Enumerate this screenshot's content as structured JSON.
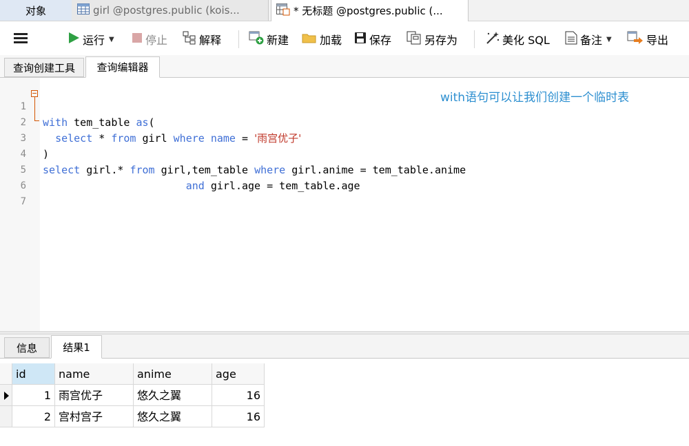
{
  "tabs": {
    "objects": "对象",
    "doc1": "girl @postgres.public (kois...",
    "doc2": "* 无标题 @postgres.public (..."
  },
  "toolbar": {
    "run": "运行",
    "stop": "停止",
    "explain": "解释",
    "new": "新建",
    "load": "加载",
    "save": "保存",
    "save_as": "另存为",
    "beautify": "美化 SQL",
    "note": "备注",
    "export": "导出"
  },
  "subtabs": {
    "builder": "查询创建工具",
    "editor": "查询编辑器"
  },
  "editor": {
    "line_numbers": [
      "1",
      "2",
      "3",
      "4",
      "5",
      "6",
      "7"
    ],
    "l1": {
      "kw1": "with",
      "t1": " tem_table ",
      "kw2": "as",
      "t2": "("
    },
    "l2": {
      "pad": "  ",
      "kw1": "select",
      "t1": " * ",
      "kw2": "from",
      "t2": " girl ",
      "kw3": "where",
      "t3": " ",
      "kw4": "name",
      "t4": " = ",
      "str": "'雨宫优子'"
    },
    "l3": {
      "t1": ")"
    },
    "l4": {
      "kw1": "select",
      "t1": " girl.* ",
      "kw2": "from",
      "t2": " girl,tem_table ",
      "kw3": "where",
      "t3": " girl.anime = tem_table.anime"
    },
    "l5": {
      "pad": "                       ",
      "kw1": "and",
      "t1": " girl.age = tem_table.age"
    },
    "annotation": "with语句可以让我们创建一个临时表"
  },
  "result_tabs": {
    "info": "信息",
    "result": "结果1"
  },
  "result": {
    "columns": [
      "id",
      "name",
      "anime",
      "age"
    ],
    "rows": [
      [
        "1",
        "雨宫优子",
        "悠久之翼",
        "16"
      ],
      [
        "2",
        "宫村宫子",
        "悠久之翼",
        "16"
      ]
    ]
  },
  "colors": {
    "keyword": "#3f6fd6",
    "string": "#c0392b",
    "annotation": "#2d8fd0",
    "run": "#2ea043"
  },
  "icons": [
    "table-icon",
    "query-icon",
    "menu-icon",
    "run-icon",
    "stop-icon",
    "explain-icon",
    "new-icon",
    "load-icon",
    "save-icon",
    "save-as-icon",
    "beautify-icon",
    "note-icon",
    "export-icon",
    "row-pointer-icon"
  ]
}
